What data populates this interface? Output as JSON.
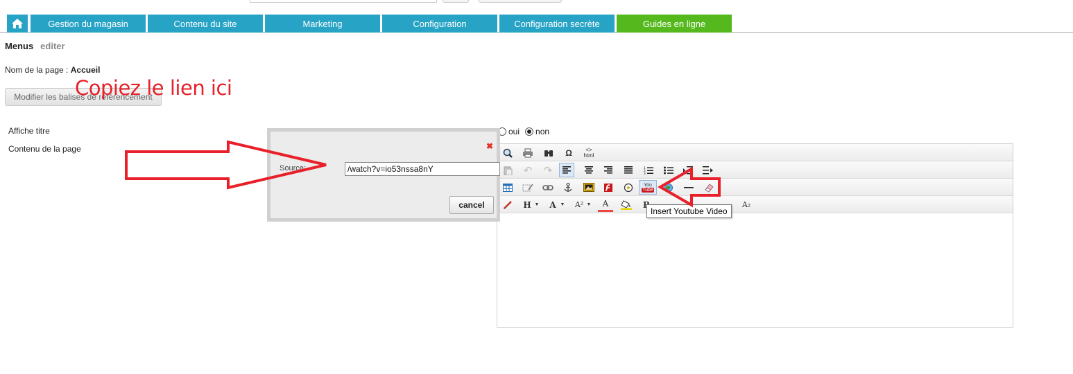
{
  "nav": {
    "home_icon": "home-icon",
    "tabs": [
      {
        "label": "Gestion du magasin",
        "color": "#27a3c6"
      },
      {
        "label": "Contenu du site",
        "color": "#27a3c6"
      },
      {
        "label": "Marketing",
        "color": "#27a3c6"
      },
      {
        "label": "Configuration",
        "color": "#27a3c6"
      },
      {
        "label": "Configuration secrète",
        "color": "#27a3c6"
      },
      {
        "label": "Guides en ligne",
        "color": "#55b91d"
      }
    ]
  },
  "page": {
    "title": "Menus",
    "subtitle": "editer",
    "name_label": "Nom de la page :",
    "name_value": "Accueil",
    "seo_button": "Modifier les balises de référencement"
  },
  "annotation": {
    "text": "Copiez le lien ici",
    "color": "#e8202a"
  },
  "form": {
    "affiche_titre_label": "Affiche titre",
    "contenu_label": "Contenu de la page",
    "radio_oui": "oui",
    "radio_non": "non",
    "selected": "non"
  },
  "editor": {
    "toolbar_row1": [
      "zoom-icon",
      "print-icon",
      "binoculars-icon",
      "omega-icon",
      "html-icon"
    ],
    "toolbar_row2": [
      "paste-icon",
      "undo-icon",
      "redo-icon",
      "align-left-icon",
      "align-center-icon",
      "align-right-icon",
      "justify-icon",
      "ordered-list-icon",
      "unordered-list-icon",
      "indent-icon",
      "outdent-icon"
    ],
    "toolbar_row3": [
      "table-icon",
      "edit-image-icon",
      "link-icon",
      "anchor-icon",
      "image-icon",
      "flash-icon",
      "media-icon",
      "youtube-icon",
      "globe-icon",
      "hr-icon",
      "eraser-icon"
    ],
    "toolbar_row4": [
      "pencil-icon",
      "heading-icon",
      "font-size-icon",
      "superscript-size-icon",
      "font-color-icon",
      "highlight-icon",
      "bold-icon",
      "subscript-icon"
    ],
    "html_label": "html",
    "youtube_label": "You Tube",
    "heading_label": "H",
    "font_label": "A",
    "font2_label": "A²",
    "color_label": "A",
    "sub_label": "A₂"
  },
  "tooltip": {
    "text": "Insert Youtube Video"
  },
  "dialog": {
    "source_label": "Source:",
    "source_value": "/watch?v=io53nssa8nY",
    "cancel": "cancel",
    "close_icon": "close-icon"
  }
}
